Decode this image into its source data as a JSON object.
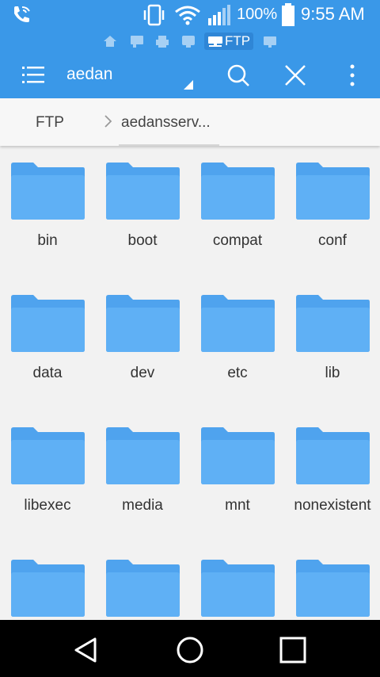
{
  "status_bar": {
    "battery_percent": "100%",
    "time": "9:55 AM"
  },
  "app_strip": {
    "active_label": "FTP",
    "icons": [
      "home-icon",
      "network-icon",
      "printer-icon",
      "wifi-share-icon",
      "ftp-icon",
      "cast-icon"
    ]
  },
  "toolbar": {
    "title": "aedan"
  },
  "breadcrumb": {
    "root": "FTP",
    "current": "aedansserv..."
  },
  "folders": [
    {
      "name": "bin"
    },
    {
      "name": "boot"
    },
    {
      "name": "compat"
    },
    {
      "name": "conf"
    },
    {
      "name": "data"
    },
    {
      "name": "dev"
    },
    {
      "name": "etc"
    },
    {
      "name": "lib"
    },
    {
      "name": "libexec"
    },
    {
      "name": "media"
    },
    {
      "name": "mnt"
    },
    {
      "name": "nonexistent"
    },
    {
      "name": ""
    },
    {
      "name": ""
    },
    {
      "name": ""
    },
    {
      "name": ""
    }
  ],
  "colors": {
    "accent": "#3a98e8",
    "folder_front": "#5fb0f5",
    "folder_back": "#4fa3ee"
  }
}
